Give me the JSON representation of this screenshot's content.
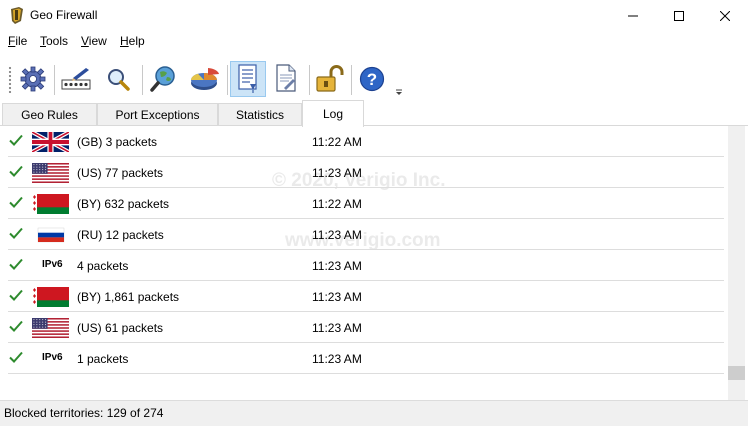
{
  "window": {
    "title": "Geo Firewall"
  },
  "menu": [
    {
      "name": "menu-file",
      "label": "File",
      "mnemonic": "F",
      "rest": "ile"
    },
    {
      "name": "menu-tools",
      "label": "Tools",
      "mnemonic": "T",
      "rest": "ools"
    },
    {
      "name": "menu-view",
      "label": "View",
      "mnemonic": "V",
      "rest": "iew"
    },
    {
      "name": "menu-help",
      "label": "Help",
      "mnemonic": "H",
      "rest": "elp"
    }
  ],
  "toolbar": {
    "buttons": [
      "gear-icon",
      "password-icon",
      "search-icon",
      "globe-search-icon",
      "pie-chart-icon",
      "log-scroll-icon",
      "document-icon",
      "unlock-icon",
      "help-icon"
    ],
    "active": "log-scroll-icon"
  },
  "tabs": [
    {
      "label": "Geo Rules",
      "active": false
    },
    {
      "label": "Port Exceptions",
      "active": false
    },
    {
      "label": "Statistics",
      "active": false
    },
    {
      "label": "Log",
      "active": true
    }
  ],
  "log": {
    "rows": [
      {
        "flag": "gb",
        "packets": "(GB) 3 packets",
        "time": "11:22 AM"
      },
      {
        "flag": "us",
        "packets": "(US) 77 packets",
        "time": "11:23 AM"
      },
      {
        "flag": "by",
        "packets": "(BY) 632 packets",
        "time": "11:22 AM"
      },
      {
        "flag": "ru",
        "packets": "(RU) 12 packets",
        "time": "11:23 AM"
      },
      {
        "flag": "ipv6",
        "ipv6_label": "IPv6",
        "packets": "4 packets",
        "time": "11:23 AM"
      },
      {
        "flag": "by",
        "packets": "(BY) 1,861 packets",
        "time": "11:23 AM"
      },
      {
        "flag": "us",
        "packets": "(US) 61 packets",
        "time": "11:23 AM"
      },
      {
        "flag": "ipv6",
        "ipv6_label": "IPv6",
        "packets": "1 packets",
        "time": "11:23 AM"
      }
    ]
  },
  "watermark": {
    "line1": "© 2020, Verigio Inc.",
    "line2": "www.verigio.com"
  },
  "status": {
    "text": "Blocked territories: 129 of 274"
  },
  "colors": {
    "check": "#2e8b2e",
    "tab_bg": "#f0f0f0",
    "status_bg": "#f0f0f0",
    "active_toolbar": "#cce4f7"
  }
}
